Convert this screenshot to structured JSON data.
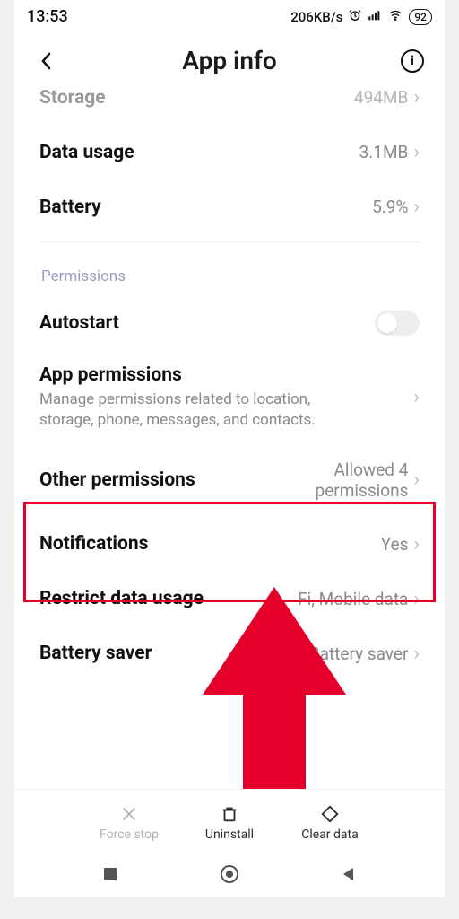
{
  "status": {
    "time": "13:53",
    "net_speed": "206KB/s",
    "battery": "92"
  },
  "header": {
    "title": "App info"
  },
  "rows": {
    "storage": {
      "label": "Storage",
      "value": "494MB"
    },
    "data": {
      "label": "Data usage",
      "value": "3.1MB"
    },
    "battery": {
      "label": "Battery",
      "value": "5.9%"
    },
    "autostart": {
      "label": "Autostart"
    },
    "appperm": {
      "label": "App permissions",
      "sub": "Manage permissions related to location, storage, phone, messages, and contacts."
    },
    "otherperm": {
      "label": "Other permissions",
      "value": "Allowed 4 permissions"
    },
    "notif": {
      "label": "Notifications",
      "value": "Yes"
    },
    "restrict": {
      "label": "Restrict data usage",
      "value": "Fi, Mobile data"
    },
    "bsaver": {
      "label": "Battery saver",
      "value": "MIUI Battery saver"
    }
  },
  "section": {
    "permissions": "Permissions"
  },
  "actions": {
    "forcestop": "Force stop",
    "uninstall": "Uninstall",
    "cleardata": "Clear data"
  }
}
